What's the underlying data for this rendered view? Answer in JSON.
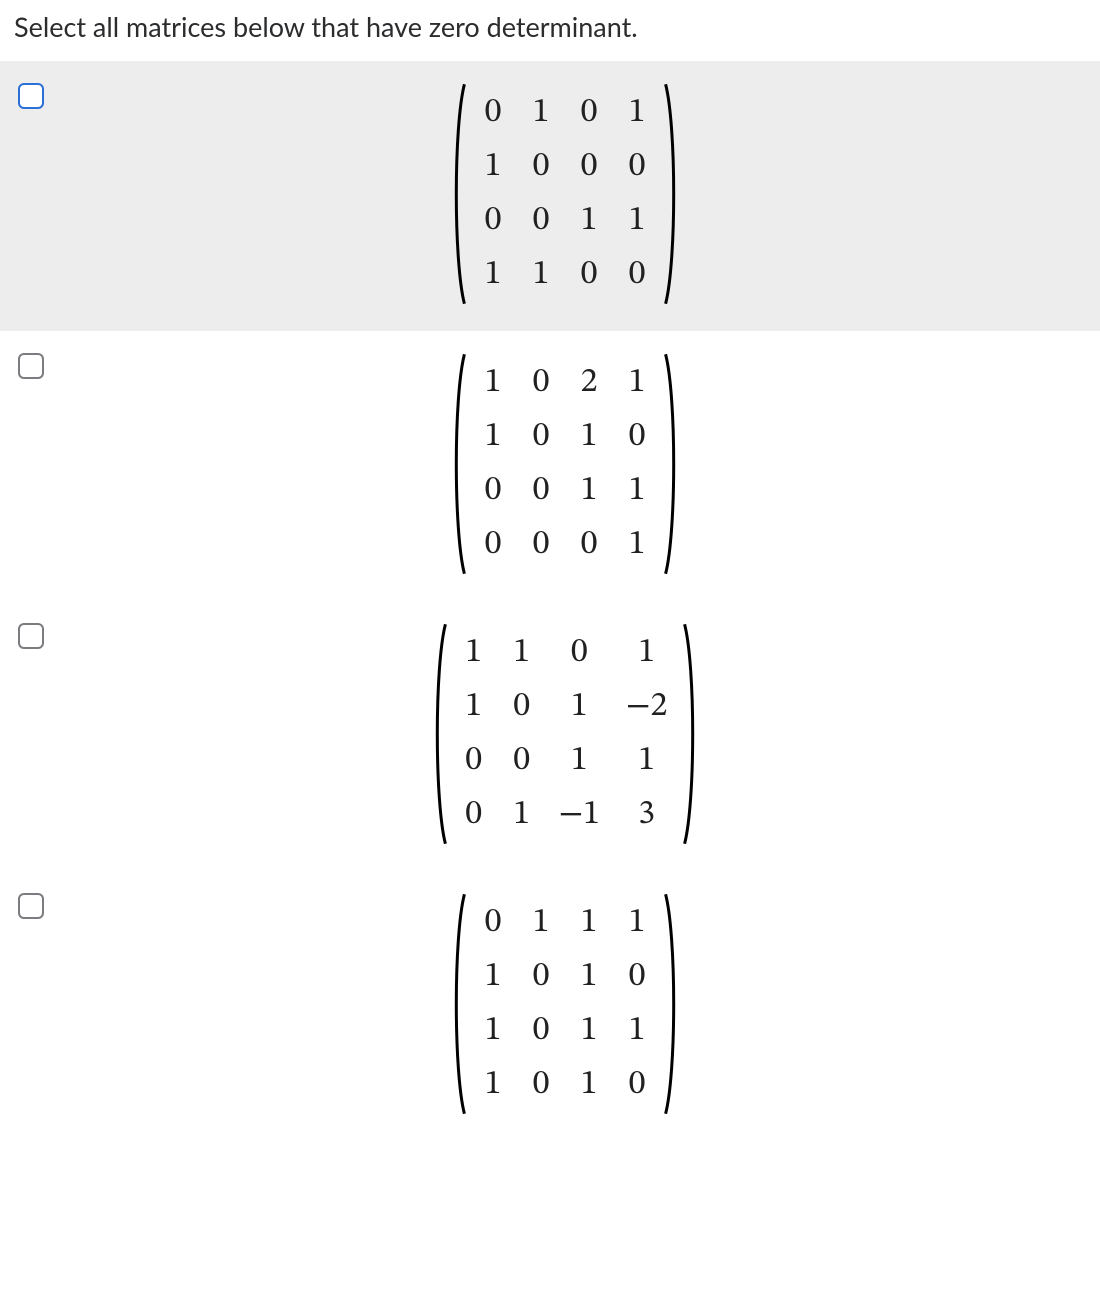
{
  "prompt": "Select all matrices below that have zero determinant.",
  "options": [
    {
      "highlighted": true,
      "matrix": [
        [
          "0",
          "1",
          "0",
          "1"
        ],
        [
          "1",
          "0",
          "0",
          "0"
        ],
        [
          "0",
          "0",
          "1",
          "1"
        ],
        [
          "1",
          "1",
          "0",
          "0"
        ]
      ]
    },
    {
      "highlighted": false,
      "matrix": [
        [
          "1",
          "0",
          "2",
          "1"
        ],
        [
          "1",
          "0",
          "1",
          "0"
        ],
        [
          "0",
          "0",
          "1",
          "1"
        ],
        [
          "0",
          "0",
          "0",
          "1"
        ]
      ]
    },
    {
      "highlighted": false,
      "matrix": [
        [
          "1",
          "1",
          "0",
          "1"
        ],
        [
          "1",
          "0",
          "1",
          "−2"
        ],
        [
          "0",
          "0",
          "1",
          "1"
        ],
        [
          "0",
          "1",
          "−1",
          "3"
        ]
      ]
    },
    {
      "highlighted": false,
      "matrix": [
        [
          "0",
          "1",
          "1",
          "1"
        ],
        [
          "1",
          "0",
          "1",
          "0"
        ],
        [
          "1",
          "0",
          "1",
          "1"
        ],
        [
          "1",
          "0",
          "1",
          "0"
        ]
      ]
    }
  ]
}
